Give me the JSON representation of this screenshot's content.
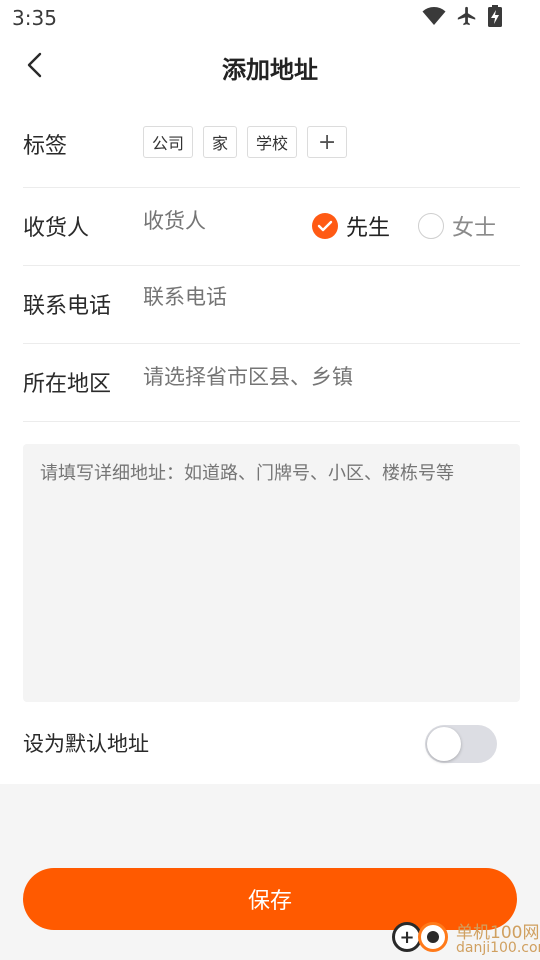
{
  "status_bar": {
    "time": "3:35",
    "icons": [
      "wifi-icon",
      "airplane-icon",
      "battery-charging-icon"
    ]
  },
  "header": {
    "title": "添加地址",
    "back_icon": "chevron-left-icon"
  },
  "form": {
    "tags": {
      "label": "标签",
      "options": [
        "公司",
        "家",
        "学校"
      ],
      "add_label": "+"
    },
    "receiver": {
      "label": "收货人",
      "placeholder": "收货人",
      "gender": {
        "male_label": "先生",
        "female_label": "女士",
        "selected": "先生"
      }
    },
    "phone": {
      "label": "联系电话",
      "placeholder": "联系电话"
    },
    "region": {
      "label": "所在地区",
      "placeholder": "请选择省市区县、乡镇"
    },
    "detail": {
      "placeholder": "请填写详细地址：如道路、门牌号、小区、楼栋号等"
    },
    "default_address": {
      "label": "设为默认地址",
      "enabled": false
    }
  },
  "actions": {
    "save_label": "保存"
  },
  "watermark": {
    "name": "单机100网",
    "domain": "danji100.com"
  },
  "colors": {
    "accent": "#ff5a00",
    "placeholder": "#c2c2c2",
    "switch_off": "#dcdde3"
  }
}
